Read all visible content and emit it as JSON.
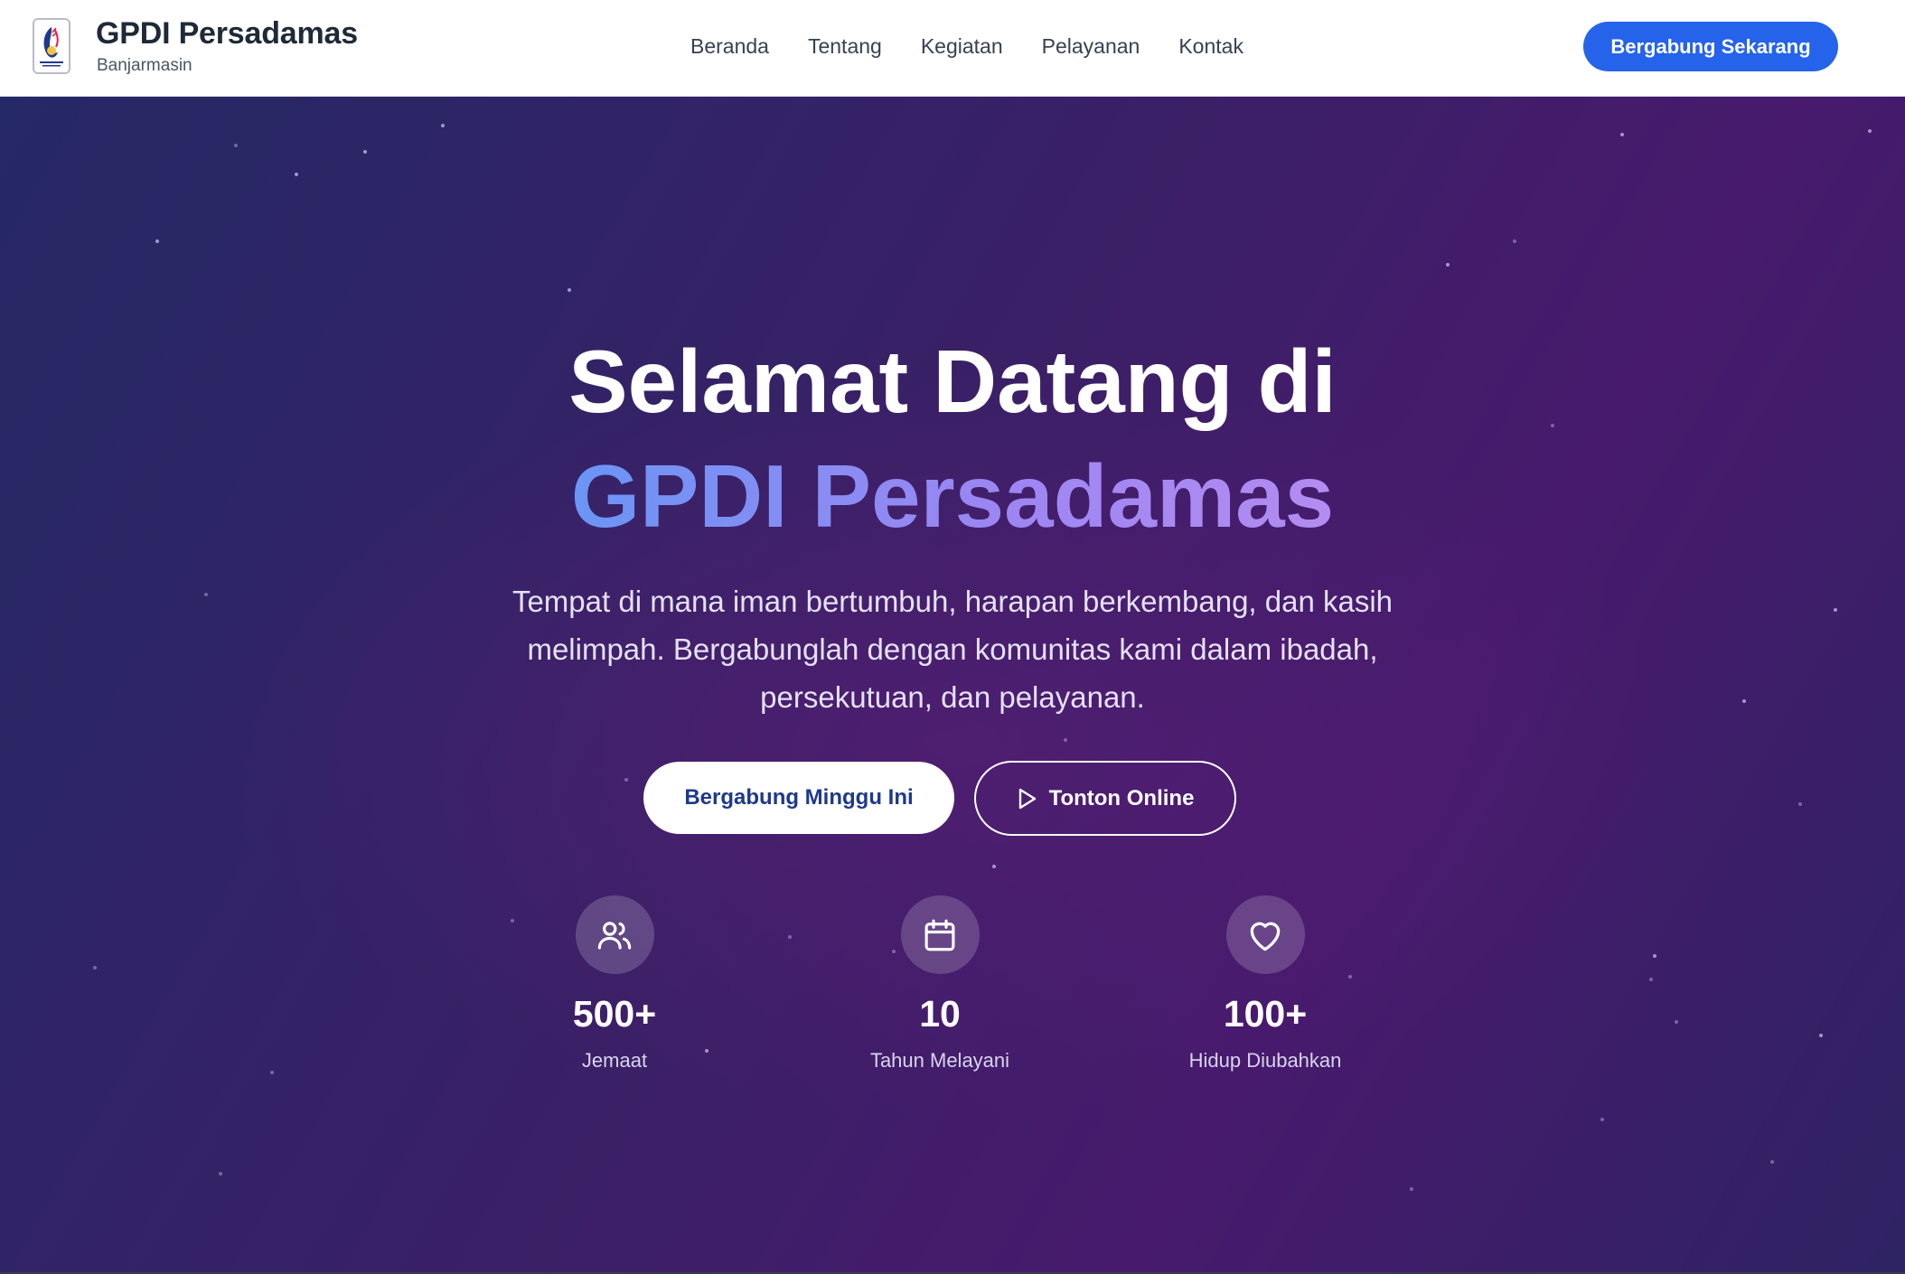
{
  "header": {
    "brand_name": "GPDI Persadamas",
    "brand_sub": "Banjarmasin",
    "nav": [
      "Beranda",
      "Tentang",
      "Kegiatan",
      "Pelayanan",
      "Kontak"
    ],
    "cta": "Bergabung Sekarang"
  },
  "hero": {
    "title_line1": "Selamat Datang di",
    "title_line2": "GPDI Persadamas",
    "lead": "Tempat di mana iman bertumbuh, harapan berkembang, dan kasih melimpah. Bergabunglah dengan komunitas kami dalam ibadah, persekutuan, dan pelayanan.",
    "primary_button": "Bergabung Minggu Ini",
    "secondary_button": "Tonton Online",
    "stats": [
      {
        "icon": "users-icon",
        "value": "500+",
        "label": "Jemaat"
      },
      {
        "icon": "calendar-icon",
        "value": "10",
        "label": "Tahun Melayani"
      },
      {
        "icon": "heart-icon",
        "value": "100+",
        "label": "Hidup Diubahkan"
      }
    ]
  },
  "colors": {
    "accent": "#2563eb",
    "gradient_start": "#6b95f5",
    "gradient_end": "#b38cf0",
    "hero_bg": "#3a2066"
  }
}
